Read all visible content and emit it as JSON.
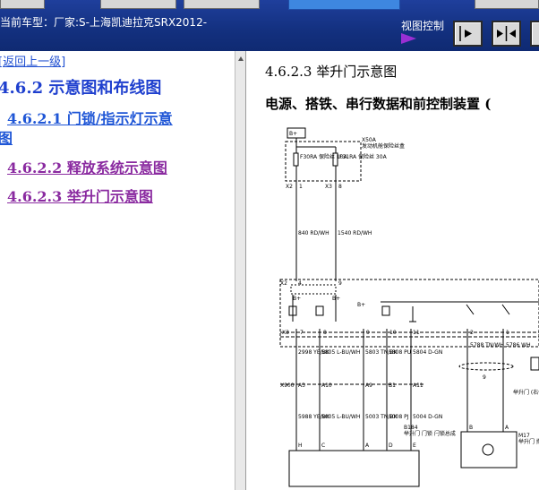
{
  "header": {
    "vehicle_label": "当前车型：厂家:S-上海凯迪拉克SRX2012-",
    "view_control_label": "视图控制"
  },
  "nav": {
    "back_link": "[返回上一级]",
    "section_462": "4.6.2 示意图和布线图",
    "item_4621_line1": "4.6.2.1 门锁/指示灯示意",
    "item_4621_line2": "图",
    "item_4622": "4.6.2.2 释放系统示意图",
    "item_4623": "4.6.2.3 举升门示意图"
  },
  "doc": {
    "title": "4.6.2.3 举升门示意图",
    "subtitle": "电源、搭铁、串行数据和前控制装置 ("
  },
  "schematic": {
    "power_label": "B+",
    "fuse_block_ref": "X50A",
    "fuse_block_name": "发动机舱保险丝盒",
    "fuse_1": "F30RA 保险丝 10A",
    "fuse_2": "F31RA 保险丝 30A",
    "conn_x2": "X2",
    "conn_x3": "X3",
    "pin_1": "1",
    "pin_8": "8",
    "wire_1": "840 RD/WH",
    "wire_2": "1540 RD/WH",
    "module_conn_x2": "X2",
    "module_pin_4": "4",
    "module_pin_9": "9",
    "module_bplus_1": "B+",
    "module_bplus_2": "B+",
    "bplus_3": "B+",
    "conn_x3_bottom": "X3",
    "pins_row": [
      "7",
      "8",
      "",
      "9",
      "10",
      "11",
      "",
      "2",
      "1"
    ],
    "wires_row": [
      "2998 YE/BK",
      "5805 L-BU/WH",
      "5803 TN/BK",
      "5808 PU",
      "5804 D-GN",
      "",
      "5788 TN/WH",
      "5786 WH"
    ],
    "conn_x900": "X900",
    "inline_pins": [
      "A3",
      "A10",
      "A9",
      "B1",
      "A11"
    ],
    "wires_row_2": [
      "5988 YE/BK",
      "5005 L-BU/WH",
      "5003 TN/BK",
      "5008 PJ",
      "5004 D-GN"
    ],
    "bottom_pins": [
      "H",
      "C",
      "A",
      "D",
      "E"
    ],
    "motor_ref": "B184",
    "motor_name": "举升门 门锁 闩锁总成",
    "m17_ref": "M17",
    "m17_name": "举升门 撑杆电机 (左)",
    "m17_pin_b": "B",
    "m17_pin_a": "A",
    "side_text": "举升门 (右侧)",
    "loop_ref": "9"
  }
}
